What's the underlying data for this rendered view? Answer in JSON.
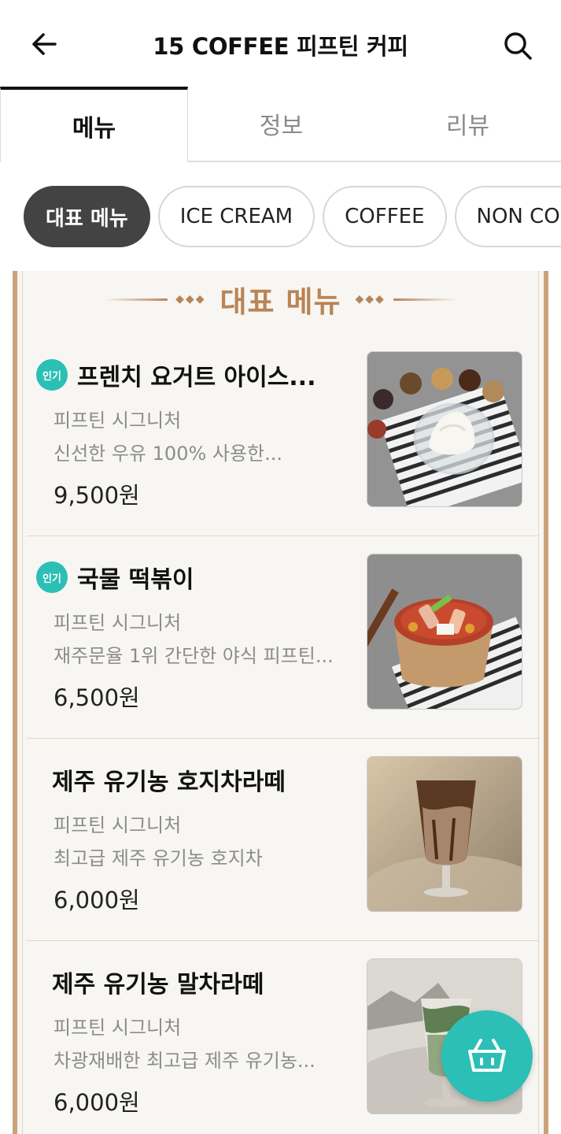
{
  "header": {
    "title": "15  COFFEE 피프틴 커피"
  },
  "tabs": [
    {
      "label": "메뉴",
      "active": true
    },
    {
      "label": "정보",
      "active": false
    },
    {
      "label": "리뷰",
      "active": false
    }
  ],
  "categories": [
    {
      "label": "대표 메뉴",
      "active": true
    },
    {
      "label": "ICE CREAM",
      "active": false
    },
    {
      "label": "COFFEE",
      "active": false
    },
    {
      "label": "NON COFFEE",
      "active": false
    }
  ],
  "section": {
    "title": "대표 메뉴"
  },
  "items": [
    {
      "badge": "인기",
      "name": "프렌치 요거트 아이스...",
      "subtitle": "피프틴 시그니처",
      "description": "신선한 우유 100% 사용한...",
      "price": "9,500원",
      "image": "yogurt-ice-cream-photo"
    },
    {
      "badge": "인기",
      "name": "국물 떡볶이",
      "subtitle": "피프틴 시그니처",
      "description": "재주문율 1위 간단한 야식 피프틴...",
      "price": "6,500원",
      "image": "tteokbokki-photo"
    },
    {
      "badge": "",
      "name": "제주 유기농 호지차라떼",
      "subtitle": "피프틴 시그니처",
      "description": "최고급 제주 유기농 호지차",
      "price": "6,000원",
      "image": "hojicha-latte-photo"
    },
    {
      "badge": "",
      "name": "제주 유기농 말차라떼",
      "subtitle": "피프틴 시그니처",
      "description": "차광재배한 최고급 제주 유기농...",
      "price": "6,000원",
      "image": "matcha-latte-photo"
    }
  ],
  "colors": {
    "accent": "#2bbfb5",
    "chip_active": "#434343",
    "frame": "#caa27a"
  }
}
